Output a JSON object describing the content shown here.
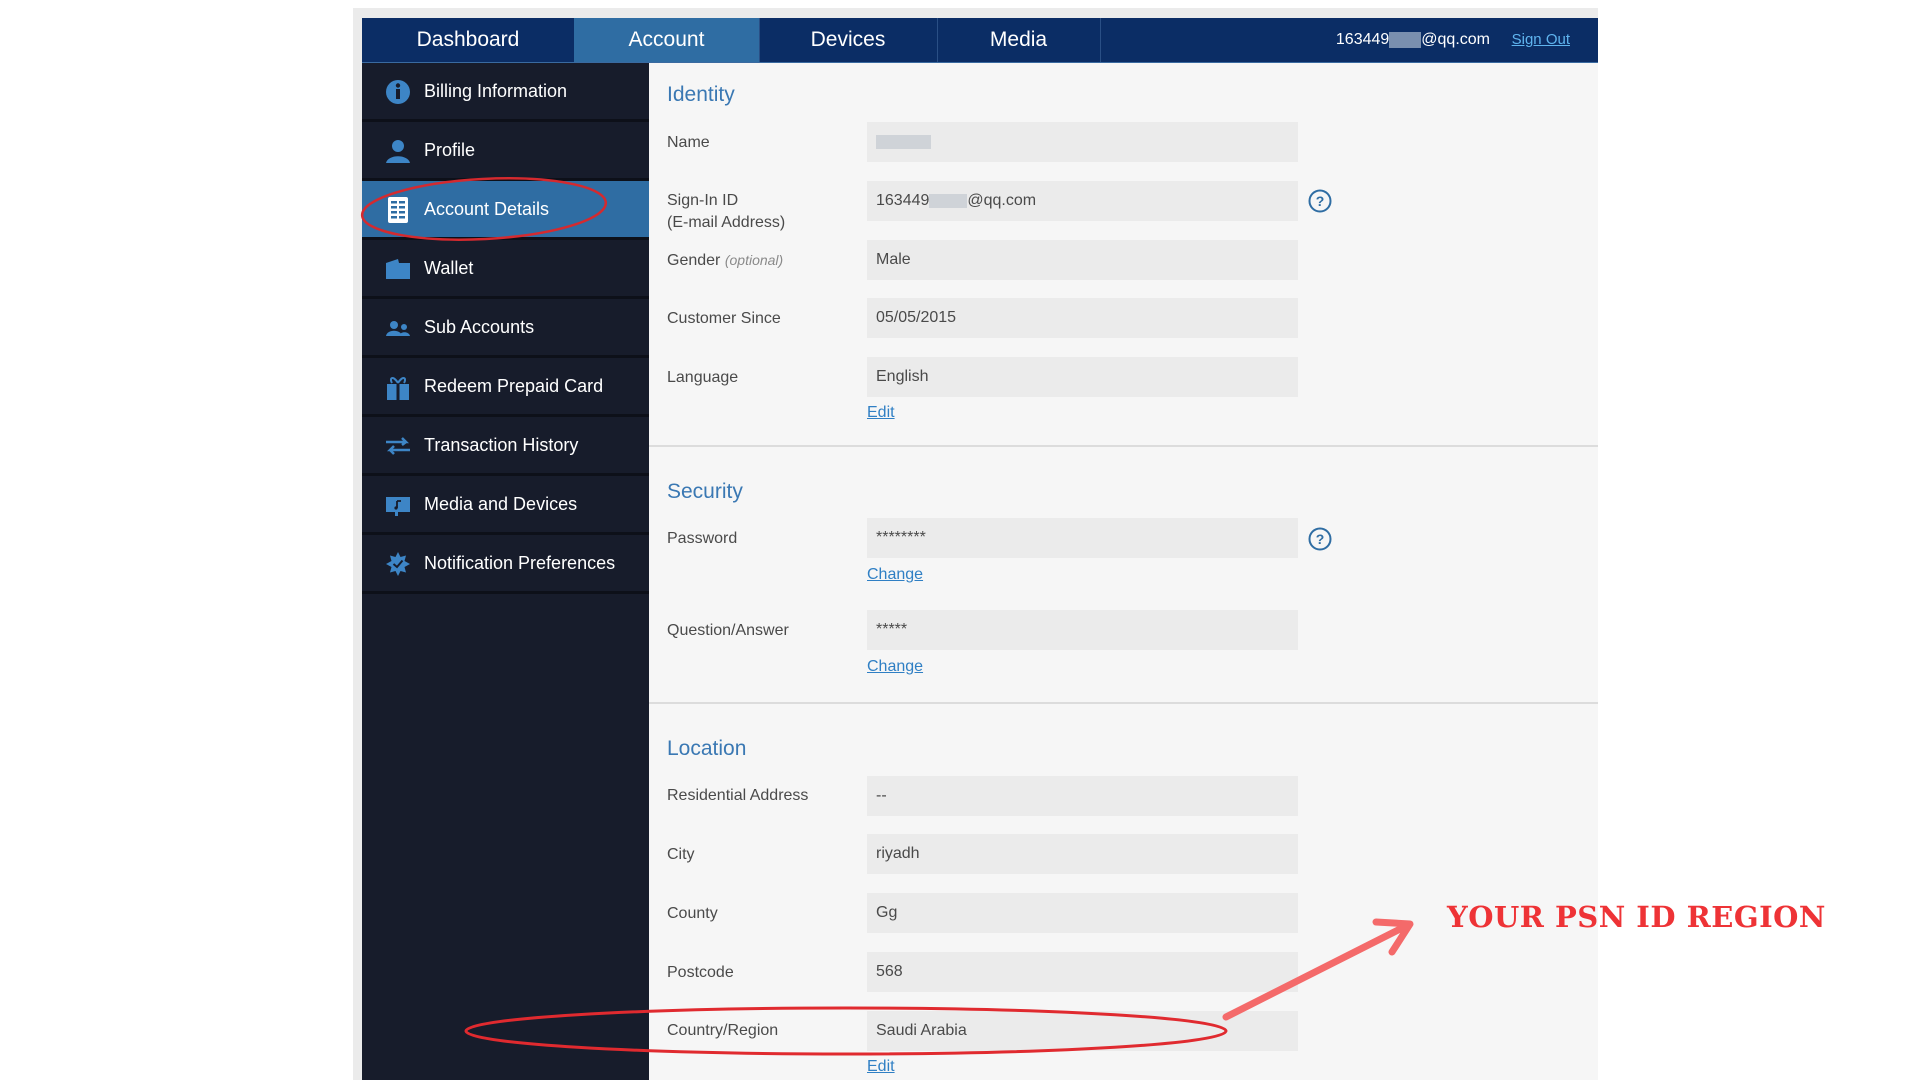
{
  "header": {
    "tabs": [
      {
        "label": "Dashboard",
        "active": false
      },
      {
        "label": "Account",
        "active": true
      },
      {
        "label": "Devices",
        "active": false
      },
      {
        "label": "Media",
        "active": false
      }
    ],
    "user_email_prefix": "163449",
    "user_email_suffix": "@qq.com",
    "sign_out": "Sign Out"
  },
  "sidebar": {
    "items": [
      {
        "label": "Billing Information",
        "icon": "info-icon"
      },
      {
        "label": "Profile",
        "icon": "person-icon"
      },
      {
        "label": "Account Details",
        "icon": "document-list-icon",
        "active": true
      },
      {
        "label": "Wallet",
        "icon": "wallet-icon"
      },
      {
        "label": "Sub Accounts",
        "icon": "users-icon"
      },
      {
        "label": "Redeem Prepaid Card",
        "icon": "gift-icon"
      },
      {
        "label": "Transaction History",
        "icon": "transfer-arrows-icon"
      },
      {
        "label": "Media and Devices",
        "icon": "media-device-icon"
      },
      {
        "label": "Notification Preferences",
        "icon": "notification-badge-icon"
      }
    ]
  },
  "identity": {
    "title": "Identity",
    "name_label": "Name",
    "name_value": "",
    "signin_label_1": "Sign-In ID",
    "signin_label_2": "(E-mail Address)",
    "signin_prefix": "163449",
    "signin_suffix": "@qq.com",
    "gender_label": "Gender",
    "gender_optional": "(optional)",
    "gender_value": "Male",
    "customer_since_label": "Customer Since",
    "customer_since_value": "05/05/2015",
    "language_label": "Language",
    "language_value": "English",
    "edit_link": "Edit"
  },
  "security": {
    "title": "Security",
    "password_label": "Password",
    "password_value": "********",
    "password_change": "Change",
    "qa_label": "Question/Answer",
    "qa_value": "*****",
    "qa_change": "Change"
  },
  "location": {
    "title": "Location",
    "address_label": "Residential Address",
    "address_value": "--",
    "city_label": "City",
    "city_value": "riyadh",
    "county_label": "County",
    "county_value": "Gg",
    "postcode_label": "Postcode",
    "postcode_value": "568",
    "country_label": "Country/Region",
    "country_value": "Saudi Arabia",
    "edit_link": "Edit"
  },
  "annotation": {
    "text": "YOUR PSN ID REGION",
    "color": "#ee3336"
  },
  "colors": {
    "header_bg": "#0b2d65",
    "active_tab": "#2f6da3",
    "sidebar_bg": "#171c2b",
    "accent_text": "#3a78b3",
    "link": "#2f7fc4"
  }
}
